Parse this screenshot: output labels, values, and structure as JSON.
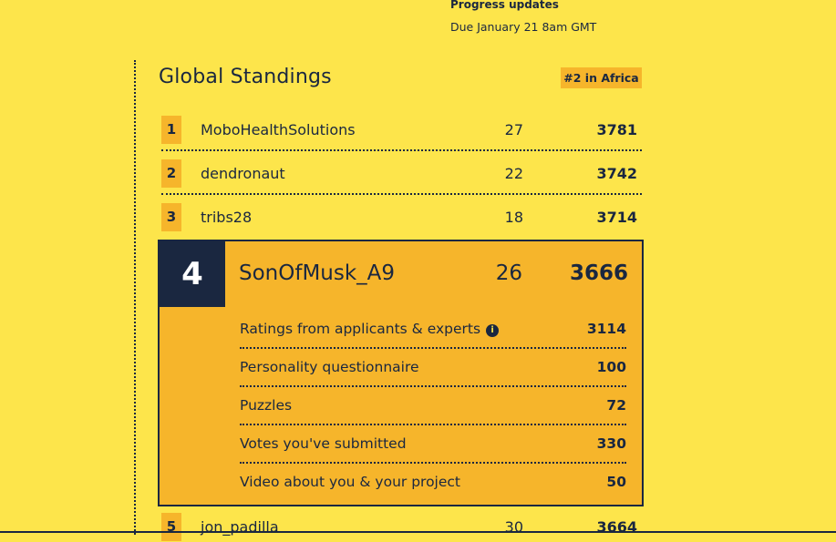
{
  "progress": {
    "title": "Progress updates",
    "due": "Due January 21 8am GMT"
  },
  "standings": {
    "title": "Global Standings",
    "badge": "#2 in Africa",
    "rows": [
      {
        "rank": "1",
        "name": "MoboHealthSolutions",
        "count": "27",
        "score": "3781"
      },
      {
        "rank": "2",
        "name": "dendronaut",
        "count": "22",
        "score": "3742"
      },
      {
        "rank": "3",
        "name": "tribs28",
        "count": "18",
        "score": "3714"
      }
    ],
    "highlight": {
      "rank": "4",
      "name": "SonOfMusk_A9",
      "count": "26",
      "score": "3666",
      "breakdown": [
        {
          "label": "Ratings from applicants & experts",
          "value": "3114",
          "info_icon": "i"
        },
        {
          "label": "Personality questionnaire",
          "value": "100"
        },
        {
          "label": "Puzzles",
          "value": "72"
        },
        {
          "label": "Votes you've submitted",
          "value": "330"
        },
        {
          "label": "Video about you & your project",
          "value": "50"
        }
      ]
    },
    "next_row": {
      "rank": "5",
      "name": "jon_padilla",
      "count": "30",
      "score": "3664"
    }
  },
  "colors": {
    "background": "#fde54b",
    "accent": "#f6b52b",
    "navy": "#1a2740"
  },
  "icons": {
    "info": "info-icon"
  }
}
